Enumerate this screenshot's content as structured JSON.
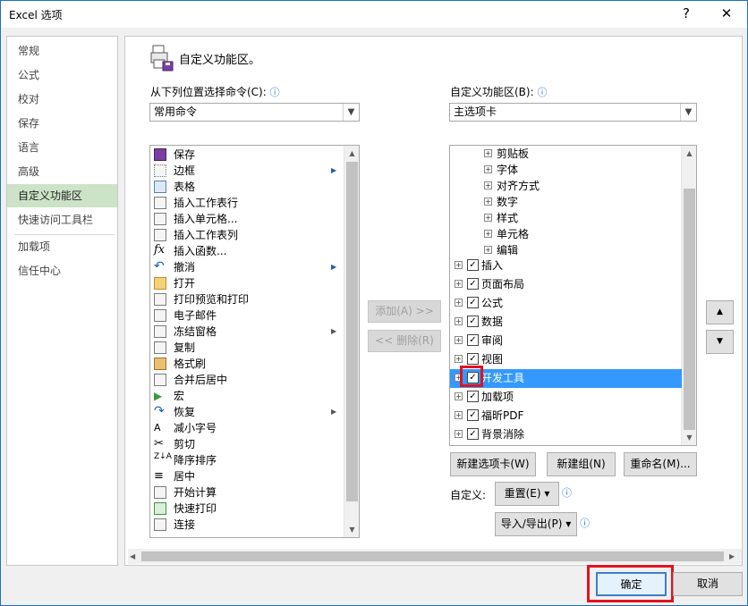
{
  "window": {
    "title": "Excel 选项",
    "help_glyph": "?",
    "close_glyph": "✕"
  },
  "nav": {
    "items": [
      {
        "label": "常规"
      },
      {
        "label": "公式"
      },
      {
        "label": "校对"
      },
      {
        "label": "保存"
      },
      {
        "label": "语言"
      },
      {
        "label": "高级"
      },
      {
        "label": "自定义功能区",
        "active": true
      },
      {
        "label": "快速访问工具栏"
      },
      {
        "label": "加载项"
      },
      {
        "label": "信任中心"
      }
    ]
  },
  "header": {
    "title": "自定义功能区。"
  },
  "left": {
    "label": "从下列位置选择命令(C):",
    "combo_value": "常用命令",
    "commands": [
      {
        "label": "保存",
        "icon": "save-icon"
      },
      {
        "label": "边框",
        "icon": "borders-icon",
        "submenu": true
      },
      {
        "label": "表格",
        "icon": "table-icon"
      },
      {
        "label": "插入工作表行",
        "icon": "insert-row-icon"
      },
      {
        "label": "插入单元格...",
        "icon": "insert-cells-icon"
      },
      {
        "label": "插入工作表列",
        "icon": "insert-column-icon"
      },
      {
        "label": "插入函数...",
        "icon": "function-icon"
      },
      {
        "label": "撤消",
        "icon": "undo-icon",
        "submenu": true
      },
      {
        "label": "打开",
        "icon": "open-folder-icon"
      },
      {
        "label": "打印预览和打印",
        "icon": "print-preview-icon"
      },
      {
        "label": "电子邮件",
        "icon": "email-icon"
      },
      {
        "label": "冻结窗格",
        "icon": "freeze-panes-icon",
        "submenu": true
      },
      {
        "label": "复制",
        "icon": "copy-icon"
      },
      {
        "label": "格式刷",
        "icon": "format-painter-icon"
      },
      {
        "label": "合并后居中",
        "icon": "merge-center-icon"
      },
      {
        "label": "宏",
        "icon": "macro-icon"
      },
      {
        "label": "恢复",
        "icon": "redo-icon",
        "submenu": true
      },
      {
        "label": "减小字号",
        "icon": "decrease-font-icon"
      },
      {
        "label": "剪切",
        "icon": "cut-icon"
      },
      {
        "label": "降序排序",
        "icon": "sort-descending-icon"
      },
      {
        "label": "居中",
        "icon": "center-align-icon"
      },
      {
        "label": "开始计算",
        "icon": "calculate-icon"
      },
      {
        "label": "快速打印",
        "icon": "quick-print-icon"
      },
      {
        "label": "连接",
        "icon": "connections-icon"
      }
    ]
  },
  "middle": {
    "add_label": "添加(A) >>",
    "remove_label": "<< 删除(R)"
  },
  "right": {
    "label": "自定义功能区(B):",
    "combo_value": "主选项卡",
    "groups": [
      {
        "label": "剪贴板"
      },
      {
        "label": "字体"
      },
      {
        "label": "对齐方式"
      },
      {
        "label": "数字"
      },
      {
        "label": "样式"
      },
      {
        "label": "单元格"
      },
      {
        "label": "编辑"
      }
    ],
    "tabs": [
      {
        "label": "插入",
        "checked": true
      },
      {
        "label": "页面布局",
        "checked": true
      },
      {
        "label": "公式",
        "checked": true
      },
      {
        "label": "数据",
        "checked": true
      },
      {
        "label": "审阅",
        "checked": true
      },
      {
        "label": "视图",
        "checked": true
      },
      {
        "label": "开发工具",
        "checked": true,
        "selected": true
      },
      {
        "label": "加载项",
        "checked": true
      },
      {
        "label": "福昕PDF",
        "checked": true
      },
      {
        "label": "背景消除",
        "checked": true
      }
    ],
    "new_tab_label": "新建选项卡(W)",
    "new_group_label": "新建组(N)",
    "rename_label": "重命名(M)...",
    "customize_label": "自定义:",
    "reset_label": "重置(E) ▾",
    "import_export_label": "导入/导出(P) ▾"
  },
  "footer": {
    "ok_label": "确定",
    "cancel_label": "取消"
  },
  "colors": {
    "accent_selection": "#3399ff",
    "nav_active": "#cde3c8",
    "highlight_box": "#e0141e"
  }
}
